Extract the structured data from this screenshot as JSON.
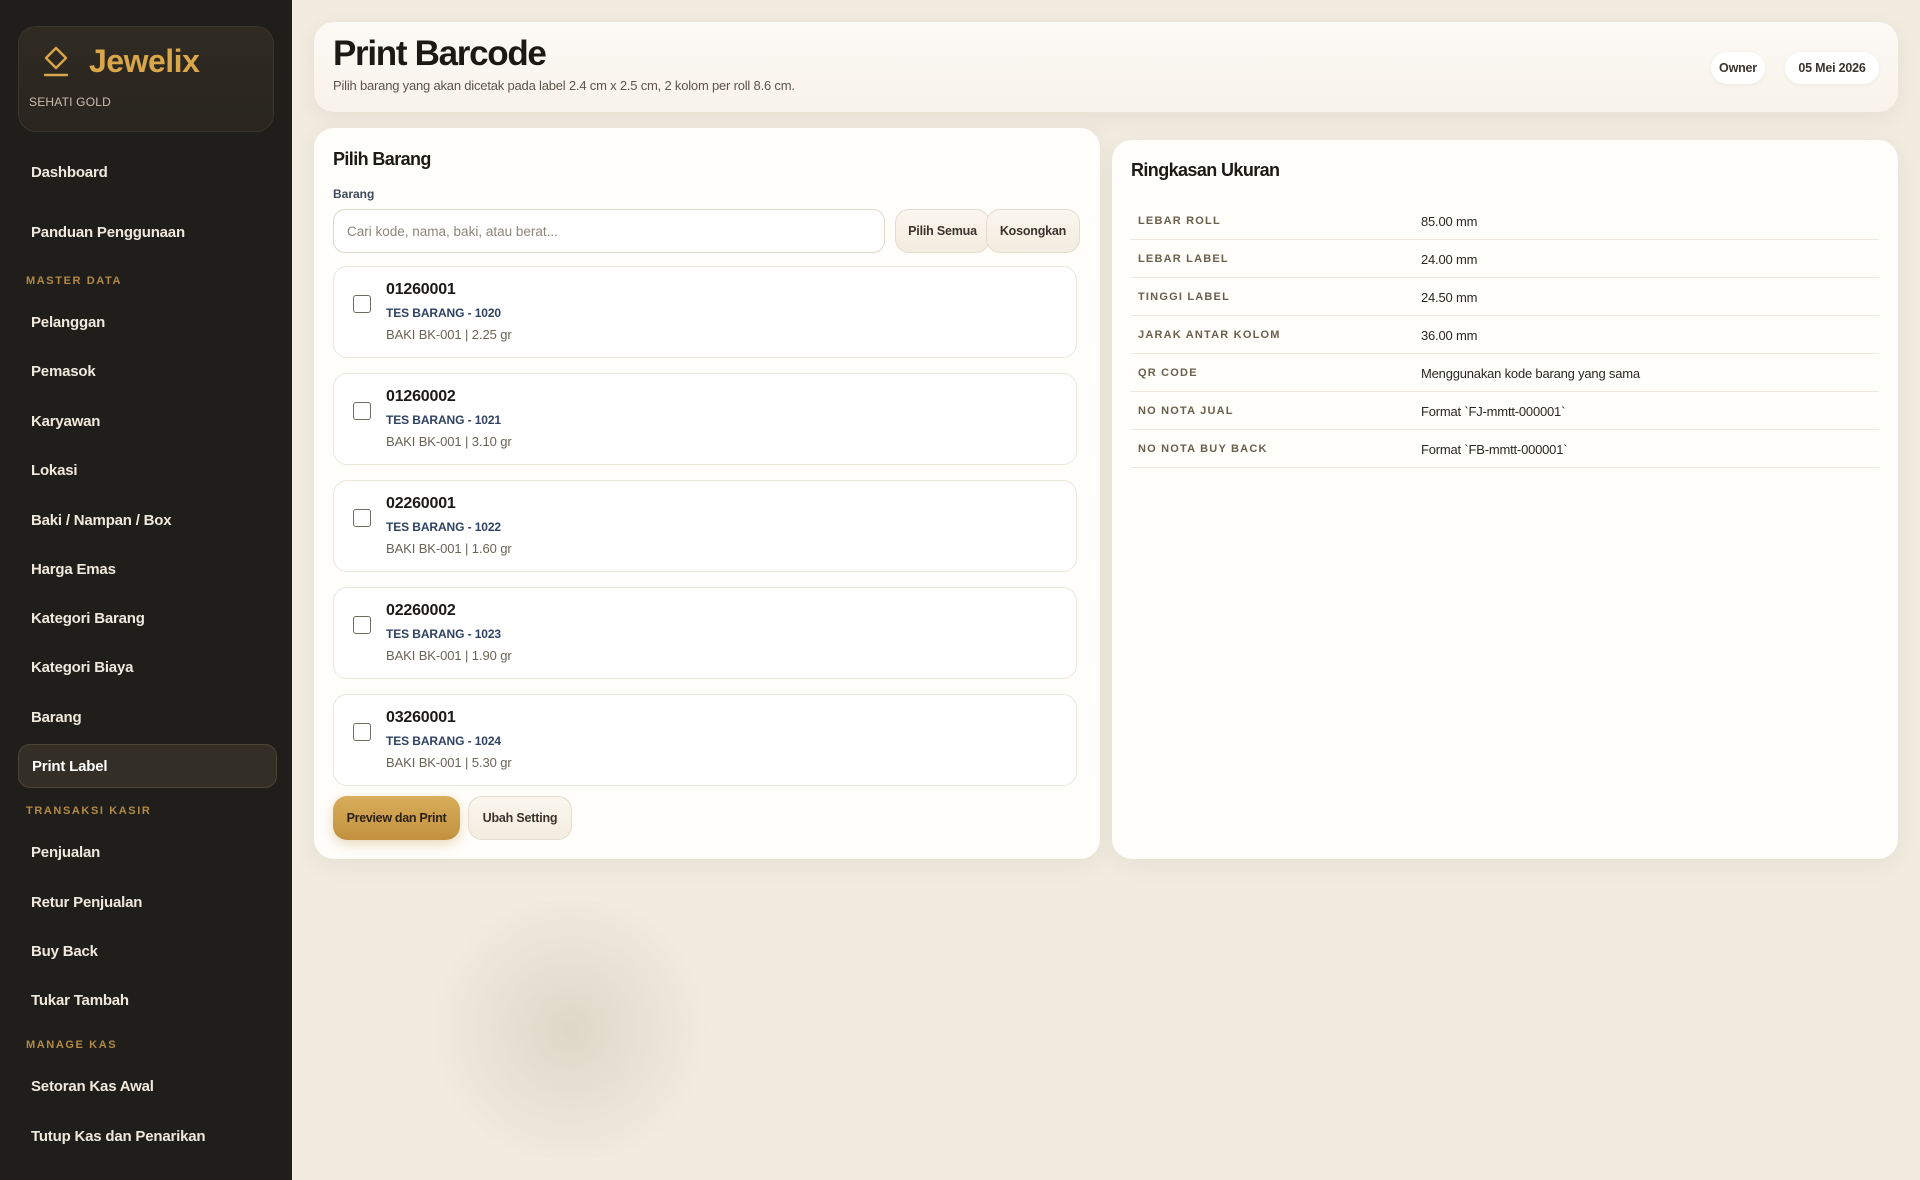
{
  "brand": {
    "name": "Jewelix",
    "subtitle": "SEHATI GOLD",
    "icon": "diamond-icon"
  },
  "sidebar": {
    "items": [
      {
        "label": "Dashboard",
        "type": "item"
      },
      {
        "label": "Panduan Penggunaan",
        "type": "item"
      },
      {
        "label": "MASTER DATA",
        "type": "section"
      },
      {
        "label": "Pelanggan",
        "type": "item"
      },
      {
        "label": "Pemasok",
        "type": "item"
      },
      {
        "label": "Karyawan",
        "type": "item"
      },
      {
        "label": "Lokasi",
        "type": "item"
      },
      {
        "label": "Baki / Nampan / Box",
        "type": "item"
      },
      {
        "label": "Harga Emas",
        "type": "item"
      },
      {
        "label": "Kategori Barang",
        "type": "item"
      },
      {
        "label": "Kategori Biaya",
        "type": "item"
      },
      {
        "label": "Barang",
        "type": "item"
      },
      {
        "label": "Print Label",
        "type": "item",
        "active": true
      },
      {
        "label": "TRANSAKSI KASIR",
        "type": "section"
      },
      {
        "label": "Penjualan",
        "type": "item"
      },
      {
        "label": "Retur Penjualan",
        "type": "item"
      },
      {
        "label": "Buy Back",
        "type": "item"
      },
      {
        "label": "Tukar Tambah",
        "type": "item"
      },
      {
        "label": "MANAGE KAS",
        "type": "section"
      },
      {
        "label": "Setoran Kas Awal",
        "type": "item"
      },
      {
        "label": "Tutup Kas dan Penarikan",
        "type": "item"
      }
    ]
  },
  "header": {
    "title": "Print Barcode",
    "subtitle": "Pilih barang yang akan dicetak pada label 2.4 cm x 2.5 cm, 2 kolom per roll 8.6 cm.",
    "role": "Owner",
    "date": "05 Mei 2026"
  },
  "pilih_barang": {
    "title": "Pilih Barang",
    "field_label": "Barang",
    "search_placeholder": "Cari kode, nama, baki, atau berat...",
    "select_all_label": "Pilih Semua",
    "clear_label": "Kosongkan",
    "items": [
      {
        "code": "01260001",
        "name": "TES BARANG - 1020",
        "meta": "BAKI BK-001 | 2.25 gr",
        "checked": false
      },
      {
        "code": "01260002",
        "name": "TES BARANG - 1021",
        "meta": "BAKI BK-001 | 3.10 gr",
        "checked": false
      },
      {
        "code": "02260001",
        "name": "TES BARANG - 1022",
        "meta": "BAKI BK-001 | 1.60 gr",
        "checked": false
      },
      {
        "code": "02260002",
        "name": "TES BARANG - 1023",
        "meta": "BAKI BK-001 | 1.90 gr",
        "checked": false
      },
      {
        "code": "03260001",
        "name": "TES BARANG - 1024",
        "meta": "BAKI BK-001 | 5.30 gr",
        "checked": false
      }
    ],
    "preview_label": "Preview dan Print",
    "settings_label": "Ubah Setting"
  },
  "ringkasan": {
    "title": "Ringkasan Ukuran",
    "rows": [
      {
        "key": "LEBAR ROLL",
        "value": "85.00 mm"
      },
      {
        "key": "LEBAR LABEL",
        "value": "24.00 mm"
      },
      {
        "key": "TINGGI LABEL",
        "value": "24.50 mm"
      },
      {
        "key": "JARAK ANTAR KOLOM",
        "value": "36.00 mm"
      },
      {
        "key": "QR CODE",
        "value": "Menggunakan kode barang yang sama"
      },
      {
        "key": "NO NOTA JUAL",
        "value": "Format `FJ-mmtt-000001`"
      },
      {
        "key": "NO NOTA BUY BACK",
        "value": "Format `FB-mmtt-000001`"
      }
    ]
  },
  "colors": {
    "accent": "#c89a48",
    "sidebar_bg": "#201e1b",
    "page_bg": "#f1ebe0"
  }
}
